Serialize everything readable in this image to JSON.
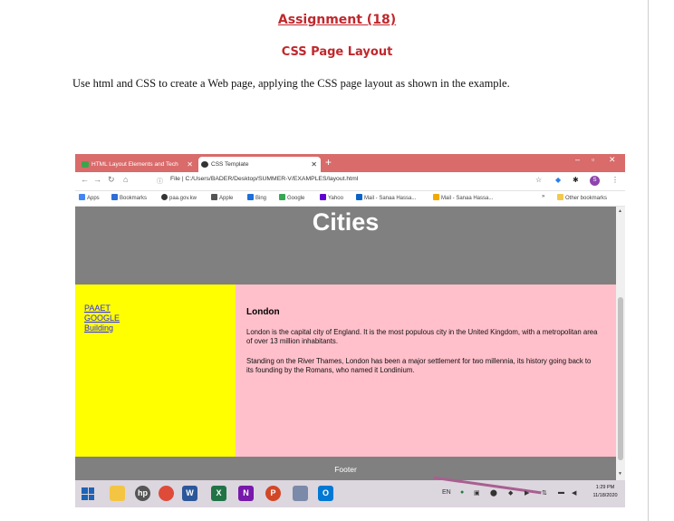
{
  "document": {
    "title": "Assignment (18)",
    "subtitle": "CSS Page Layout",
    "instruction": "Use html and CSS to create a Web page, applying the CSS page layout as shown in the example."
  },
  "browser": {
    "tabs": [
      {
        "label": "HTML Layout Elements and Tech",
        "active": false
      },
      {
        "label": "CSS Template",
        "active": true
      }
    ],
    "url": "File | C:/Users/BADER/Desktop/SUMMER-V/EXAMPLES/layout.html",
    "profile_initial": "S",
    "bookmarks": [
      {
        "label": "Apps",
        "color": "#4285f4"
      },
      {
        "label": "Bookmarks",
        "color": "#2d6fd6"
      },
      {
        "label": "paa.gov.kw",
        "color": "#333333"
      },
      {
        "label": "Apple",
        "color": "#555555"
      },
      {
        "label": "Bing",
        "color": "#1e6fd9"
      },
      {
        "label": "Google",
        "color": "#34a853"
      },
      {
        "label": "Yahoo",
        "color": "#6001d2"
      },
      {
        "label": "Mail - Sanaa Hassa...",
        "color": "#0a64c8"
      },
      {
        "label": "Mail - Sanaa Hassa...",
        "color": "#f2a900"
      }
    ],
    "other_bookmarks": "Other bookmarks"
  },
  "site": {
    "header_title": "Cities",
    "nav_links": [
      "PAAET",
      "GOOGLE",
      "Building"
    ],
    "article_title": "London",
    "paragraphs": [
      "London is the capital city of England. It is the most populous city in the United Kingdom, with a metropolitan area of over 13 million inhabitants.",
      "Standing on the River Thames, London has been a major settlement for two millennia, its history going back to its founding by the Romans, who named it Londinium."
    ],
    "footer": "Footer",
    "colors": {
      "header": "#808080",
      "nav": "#ffff00",
      "main": "#ffc0cb",
      "link": "#2b2bff"
    }
  },
  "taskbar": {
    "language": "EN",
    "time": "1:29 PM",
    "date": "11/18/2020"
  }
}
